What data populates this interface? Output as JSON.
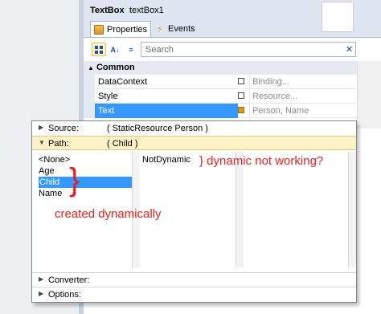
{
  "panel": {
    "type_label": "TextBox",
    "name_value": "textBox1",
    "tabs": [
      {
        "label": "Properties",
        "icon": "properties-icon"
      },
      {
        "label": "Events",
        "icon": "lightning-icon"
      }
    ],
    "search_placeholder": "Search",
    "search_clear": "✕",
    "category": "Common",
    "rows": [
      {
        "name": "DataContext",
        "value": "Binding..."
      },
      {
        "name": "Style",
        "value": "Resource..."
      },
      {
        "name": "Text",
        "value": "Person, Name"
      }
    ]
  },
  "editor": {
    "source_label": "Source:",
    "source_value": "( StaticResource Person )",
    "path_label": "Path:",
    "path_value": "( Child )",
    "path_items": [
      "<None>",
      "Age",
      "Child",
      "Name"
    ],
    "selected_index": 2,
    "child_items": [
      "NotDynamic"
    ],
    "converter_label": "Converter:",
    "options_label": "Options:"
  },
  "annotations": {
    "dynamic_text": "} dynamic not working?",
    "created_text": "created dynamically",
    "color": "#e02222"
  }
}
